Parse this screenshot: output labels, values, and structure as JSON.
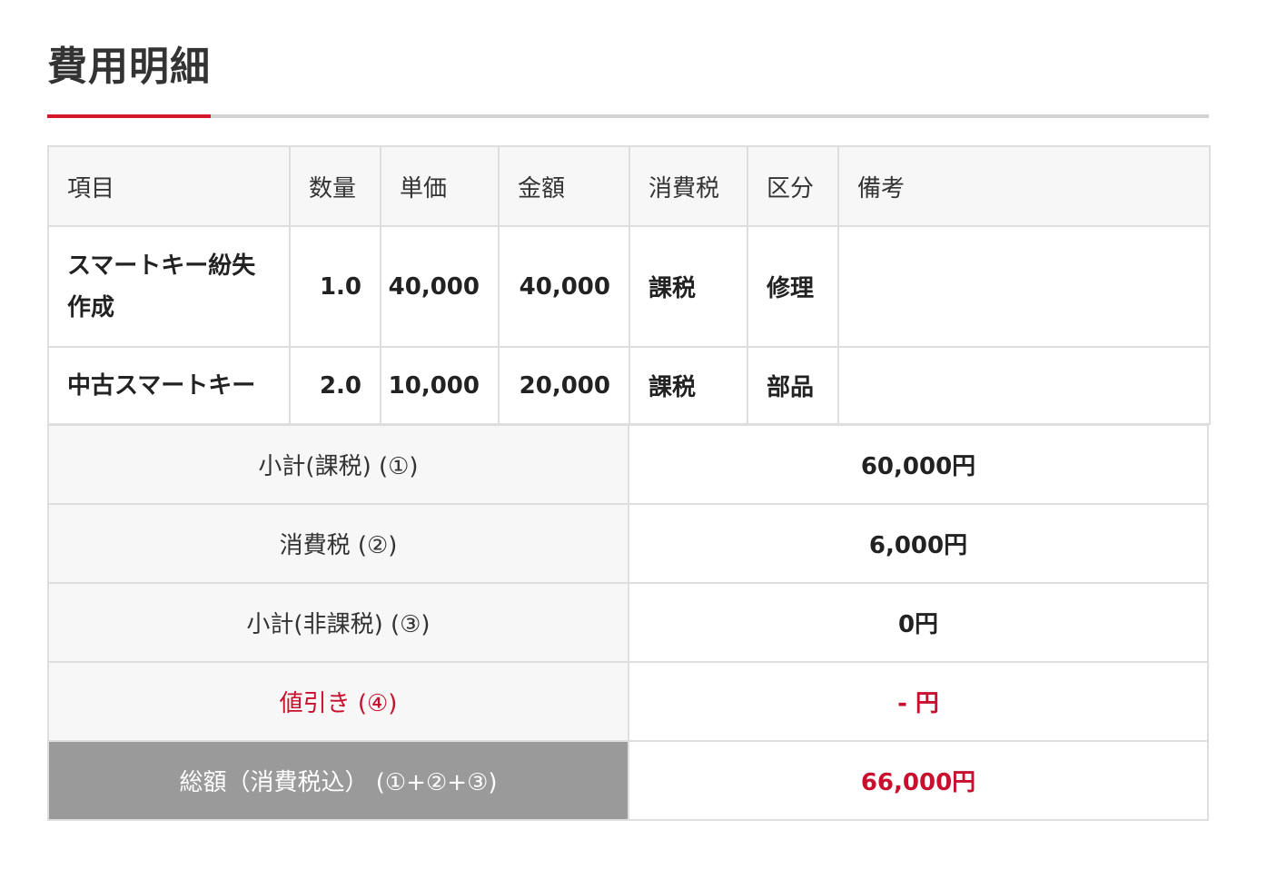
{
  "page": {
    "title": "費用明細"
  },
  "table": {
    "headers": [
      "項目",
      "数量",
      "単価",
      "金額",
      "消費税",
      "区分",
      "備考"
    ],
    "rows": [
      {
        "item": "スマートキー紛失作成",
        "qty": "1.0",
        "unit_price": "40,000",
        "amount": "40,000",
        "tax": "課税",
        "category": "修理",
        "note": ""
      },
      {
        "item": "中古スマートキー",
        "qty": "2.0",
        "unit_price": "10,000",
        "amount": "20,000",
        "tax": "課税",
        "category": "部品",
        "note": ""
      }
    ]
  },
  "summary": {
    "subtotal_taxable": {
      "label": "小計(課税) (①)",
      "value": "60,000円"
    },
    "consumption_tax": {
      "label": "消費税 (②)",
      "value": "6,000円"
    },
    "subtotal_nontaxable": {
      "label": "小計(非課税) (③)",
      "value": "0円"
    },
    "discount": {
      "label": "値引き (④)",
      "value": "- 円"
    },
    "total": {
      "label": "総額（消費税込） (①+②+③)",
      "value": "66,000円"
    }
  },
  "colors": {
    "accent": "#d6182a",
    "discount_red": "#c8102e",
    "total_label_bg": "#9a9a9a"
  }
}
